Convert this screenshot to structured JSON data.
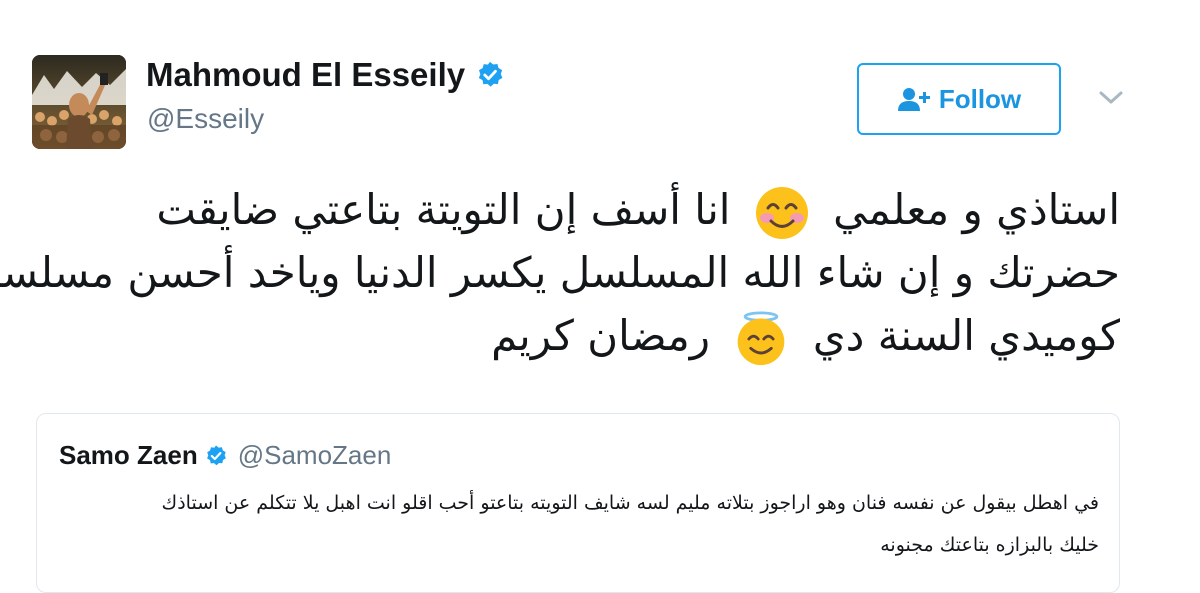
{
  "author": {
    "name": "Mahmoud El Esseily",
    "handle": "@Esseily",
    "verified": true
  },
  "follow_button": {
    "label": "Follow",
    "icon": "add-person-icon"
  },
  "menu": {
    "icon": "chevron-down-icon"
  },
  "tweet": {
    "line1_before_emoji": "استاذي و معلمي",
    "line1_after_emoji": "انا أسف إن التويتة بتاعتي ضايقت",
    "line2": "حضرتك و إن شاء الله المسلسل يكسر الدنيا وياخد أحسن مسلسل",
    "line3_before_emoji": "كوميدي السنة دي",
    "line3_after_emoji": "رمضان كريم",
    "emoji1": "smiling-face-with-smiling-eyes",
    "emoji2": "smiling-face-with-halo"
  },
  "quoted_tweet": {
    "name": "Samo Zaen",
    "handle": "@SamoZaen",
    "verified": true,
    "line1": "في اهطل بيقول عن نفسه فنان وهو اراجوز بتلاته مليم لسه شايف التويته بتاعتو أحب اقلو انت اهبل يلا تتكلم عن استاذك",
    "line2": "خليك بالبزازه بتاعتك مجنونه"
  },
  "colors": {
    "accent": "#1da1f2",
    "verified": "#1da1f2",
    "secondary_text": "#657786",
    "border": "#e1e8ed"
  }
}
